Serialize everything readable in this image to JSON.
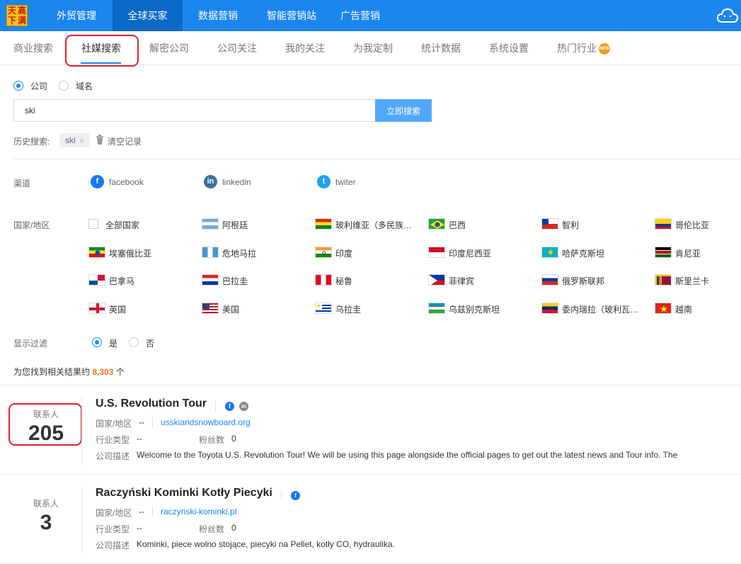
{
  "logo": {
    "chars": [
      "天",
      "高",
      "下",
      "满"
    ]
  },
  "top_nav": {
    "items": [
      {
        "label": "外贸管理"
      },
      {
        "label": "全球买家"
      },
      {
        "label": "数据营销"
      },
      {
        "label": "智能营销站"
      },
      {
        "label": "广告营销"
      }
    ],
    "active": "全球买家"
  },
  "sub_nav": {
    "items": [
      {
        "label": "商业搜索"
      },
      {
        "label": "社媒搜索"
      },
      {
        "label": "解密公司"
      },
      {
        "label": "公司关注"
      },
      {
        "label": "我的关注"
      },
      {
        "label": "为我定制"
      },
      {
        "label": "统计数据"
      },
      {
        "label": "系统设置"
      },
      {
        "label": "热门行业"
      }
    ],
    "active": "社媒搜索",
    "new_badge": "NEW"
  },
  "search_type": {
    "options": [
      "公司",
      "域名"
    ],
    "selected": "公司"
  },
  "search": {
    "value": "ski",
    "button": "立即搜索"
  },
  "history": {
    "label": "历史搜索:",
    "tags": [
      "ski"
    ],
    "close": "×",
    "clear_label": "清空记录"
  },
  "channels": {
    "label": "渠道",
    "items": [
      "facebook",
      "linkedin",
      "twiter"
    ]
  },
  "countries": {
    "label": "国家/地区",
    "all_label": "全部国家",
    "items": [
      "阿根廷",
      "玻利维亚（多民族…",
      "巴西",
      "智利",
      "哥伦比亚",
      "埃塞俄比亚",
      "危地马拉",
      "印度",
      "印度尼西亚",
      "哈萨克斯坦",
      "肯尼亚",
      "巴拿马",
      "巴拉圭",
      "秘鲁",
      "菲律宾",
      "俄罗斯联邦",
      "斯里兰卡",
      "英国",
      "美国",
      "乌拉圭",
      "乌兹别克斯坦",
      "委内瑞拉（玻利瓦…",
      "越南"
    ]
  },
  "filter": {
    "label": "显示过滤",
    "options": [
      "是",
      "否"
    ],
    "selected": "是"
  },
  "result_summary": {
    "prefix": "为您找到相关结果约 ",
    "count": "8,303",
    "suffix": " 个"
  },
  "field_labels": {
    "country": "国家/地区",
    "industry": "行业类型",
    "fans": "粉丝数",
    "desc": "公司描述",
    "contacts": "联系人"
  },
  "results": [
    {
      "title": "U.S. Revolution Tour",
      "contacts": "205",
      "country": "--",
      "website": "usskiandsnowboard.org",
      "industry": "--",
      "fans": "0",
      "description": "Welcome to the Toyota U.S. Revolution Tour! We will be using this page alongside the official pages to get out the latest news and Tour info. The"
    },
    {
      "title": "Raczyński Kominki Kotły Piecyki",
      "contacts": "3",
      "country": "--",
      "website": "raczynski-kominki.pl",
      "industry": "--",
      "fans": "0",
      "description": "Kominki, piece wolno stojące, piecyki na Pellet, kotły CO, hydraulika."
    }
  ],
  "colors": {
    "primary": "#1c86ef",
    "accent": "#e8741b",
    "highlight": "#e2232a"
  }
}
